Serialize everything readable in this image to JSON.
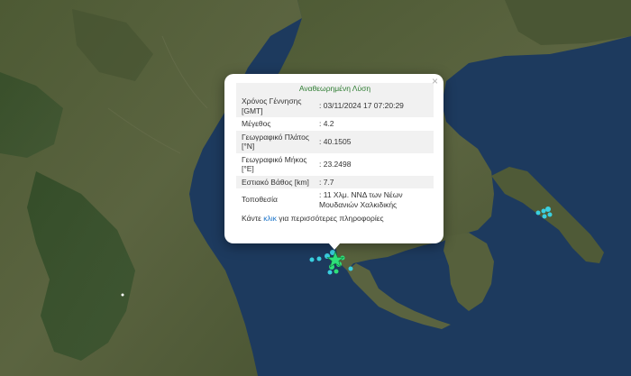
{
  "popup": {
    "header": "Αναθεωρημένη Λύση",
    "close_symbol": "×",
    "rows": [
      {
        "label": "Χρόνος Γέννησης [GMT]",
        "value": ": 03/11/2024 17 07:20:29"
      },
      {
        "label": "Μέγεθος",
        "value": ": 4.2"
      },
      {
        "label": "Γεωγραφικό Πλάτος [°N]",
        "value": ": 40.1505"
      },
      {
        "label": "Γεωγραφικό Μήκος [°E]",
        "value": ": 23.2498"
      },
      {
        "label": "Εστιακό Βάθος [km]",
        "value": ": 7.7"
      },
      {
        "label": "Τοποθεσία",
        "value": ": 11 Χλμ. ΝΝΔ των Νέων Μουδανιών Χαλκιδικής"
      }
    ],
    "footer_prefix": "Κάντε ",
    "footer_link": "κλικ",
    "footer_suffix": " για περισσότερες πληροφορίες"
  },
  "colors": {
    "sea": "#1d3a5e",
    "land": "#56603a",
    "header_text": "#2e7d32",
    "link": "#1a73c9",
    "quake_recent": "#2ee07a",
    "quake_older": "#3ad0e0"
  },
  "icons": {
    "epicenter": "star-icon",
    "events": "circle-marker"
  }
}
